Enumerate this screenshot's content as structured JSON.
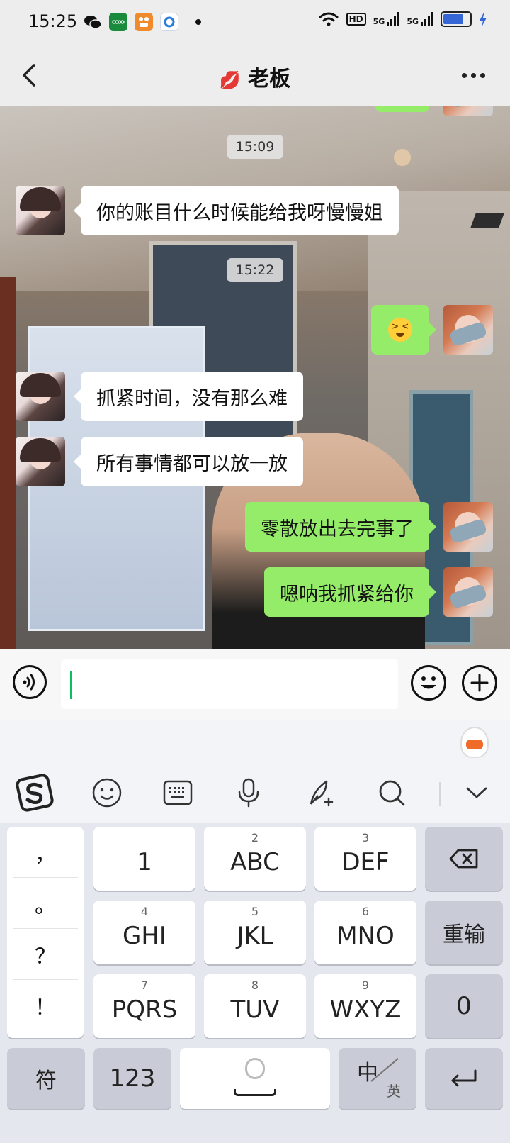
{
  "status_bar": {
    "time": "15:25",
    "icons": [
      "wechat-icon",
      "green-app-icon",
      "orange-app-icon",
      "blue-app-icon",
      "dot-icon",
      "wifi-icon",
      "hd-icon",
      "signal-5g-icon",
      "signal-5g-icon",
      "battery-icon",
      "charging-icon"
    ],
    "hd_label": "HD",
    "net_label_1": "5G",
    "net_label_2": "5G"
  },
  "header": {
    "title": "老板",
    "title_emoji": "💋"
  },
  "messages": [
    {
      "type": "time",
      "text": "15:09"
    },
    {
      "type": "in",
      "text": "你的账目什么时候能给我呀慢慢姐"
    },
    {
      "type": "time",
      "text": "15:22"
    },
    {
      "type": "out",
      "emoji": "grimacing-face-icon"
    },
    {
      "type": "in",
      "text": "抓紧时间，没有那么难"
    },
    {
      "type": "in",
      "text": "所有事情都可以放一放"
    },
    {
      "type": "out",
      "text": "零散放出去完事了"
    },
    {
      "type": "out",
      "text": "嗯呐我抓紧给你"
    }
  ],
  "input": {
    "value": ""
  },
  "keyboard": {
    "punctuation": [
      "，",
      "。",
      "？",
      "！"
    ],
    "keys": [
      {
        "num": "",
        "label": "1"
      },
      {
        "num": "2",
        "label": "ABC"
      },
      {
        "num": "3",
        "label": "DEF"
      },
      {
        "num": "4",
        "label": "GHI"
      },
      {
        "num": "5",
        "label": "JKL"
      },
      {
        "num": "6",
        "label": "MNO"
      },
      {
        "num": "7",
        "label": "PQRS"
      },
      {
        "num": "8",
        "label": "TUV"
      },
      {
        "num": "9",
        "label": "WXYZ"
      }
    ],
    "reinput": "重输",
    "zero": "0",
    "symbols": "符",
    "numbers": "123",
    "lang_zh": "中",
    "lang_en": "英"
  }
}
